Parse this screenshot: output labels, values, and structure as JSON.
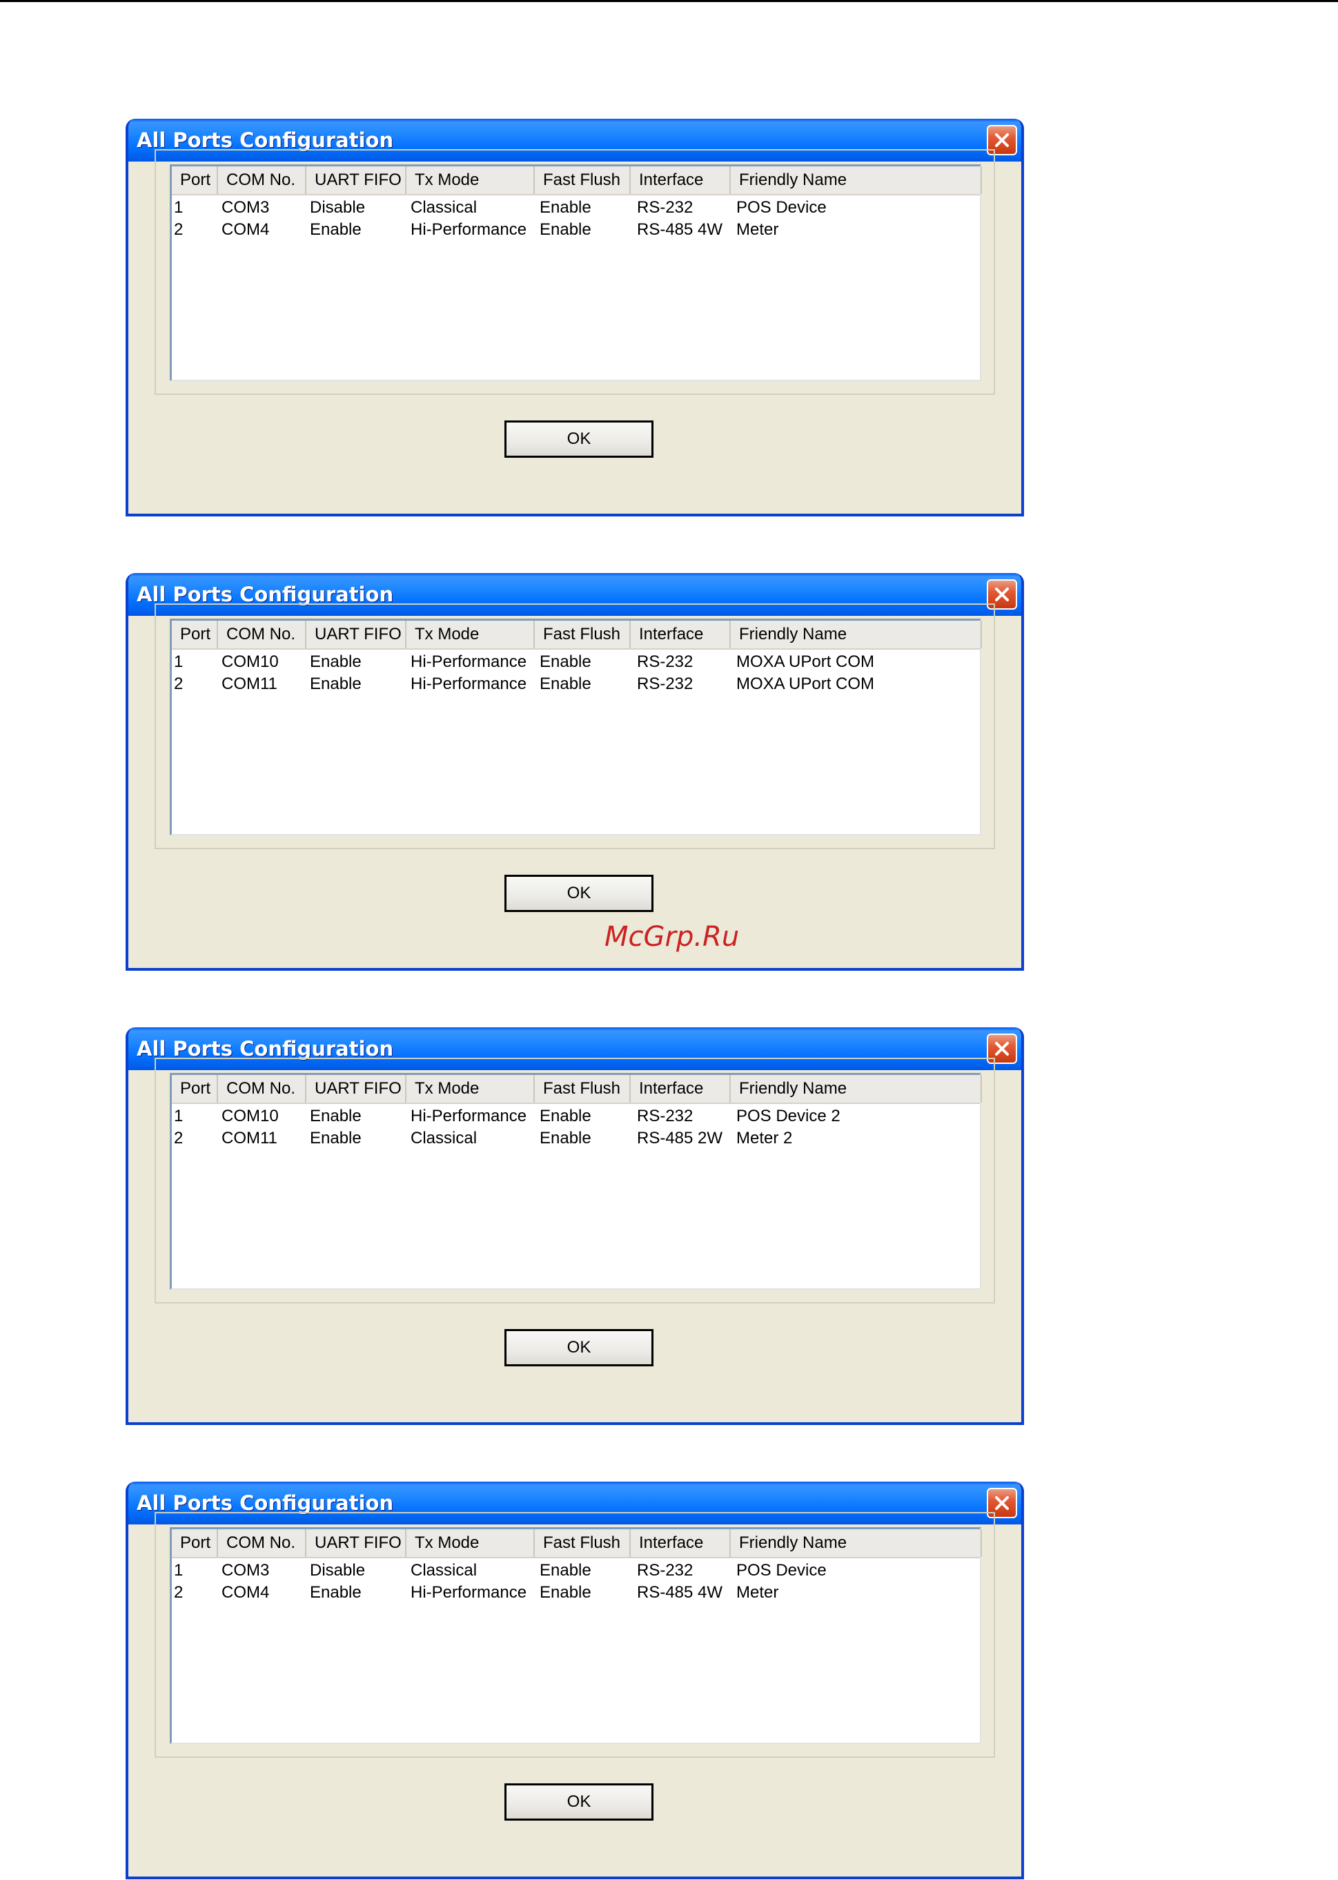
{
  "watermark": "McGrp.Ru",
  "dialogs": [
    {
      "title": "All Ports Configuration",
      "ok_label": "OK",
      "columns": [
        "Port",
        "COM No.",
        "UART FIFO",
        "Tx Mode",
        "Fast Flush",
        "Interface",
        "Friendly Name"
      ],
      "rows": [
        [
          "1",
          "COM3",
          "Disable",
          "Classical",
          "Enable",
          "RS-232",
          "POS Device"
        ],
        [
          "2",
          "COM4",
          "Enable",
          "Hi-Performance",
          "Enable",
          "RS-485 4W",
          "Meter"
        ]
      ]
    },
    {
      "title": "All Ports Configuration",
      "ok_label": "OK",
      "columns": [
        "Port",
        "COM No.",
        "UART FIFO",
        "Tx Mode",
        "Fast Flush",
        "Interface",
        "Friendly Name"
      ],
      "rows": [
        [
          "1",
          "COM10",
          "Enable",
          "Hi-Performance",
          "Enable",
          "RS-232",
          "MOXA UPort COM"
        ],
        [
          "2",
          "COM11",
          "Enable",
          "Hi-Performance",
          "Enable",
          "RS-232",
          "MOXA UPort COM"
        ]
      ]
    },
    {
      "title": "All Ports Configuration",
      "ok_label": "OK",
      "columns": [
        "Port",
        "COM No.",
        "UART FIFO",
        "Tx Mode",
        "Fast Flush",
        "Interface",
        "Friendly Name"
      ],
      "rows": [
        [
          "1",
          "COM10",
          "Enable",
          "Hi-Performance",
          "Enable",
          "RS-232",
          "POS Device 2"
        ],
        [
          "2",
          "COM11",
          "Enable",
          "Classical",
          "Enable",
          "RS-485 2W",
          "Meter 2"
        ]
      ]
    },
    {
      "title": "All Ports Configuration",
      "ok_label": "OK",
      "columns": [
        "Port",
        "COM No.",
        "UART FIFO",
        "Tx Mode",
        "Fast Flush",
        "Interface",
        "Friendly Name"
      ],
      "rows": [
        [
          "1",
          "COM3",
          "Disable",
          "Classical",
          "Enable",
          "RS-232",
          "POS Device"
        ],
        [
          "2",
          "COM4",
          "Enable",
          "Hi-Performance",
          "Enable",
          "RS-485 4W",
          "Meter"
        ]
      ]
    }
  ]
}
